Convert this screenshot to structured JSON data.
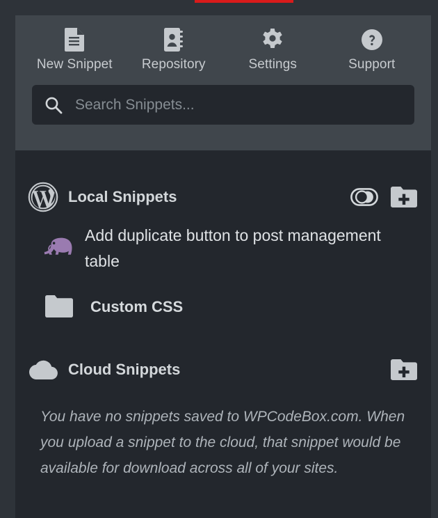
{
  "app": {
    "accent_color": "#d91b1b",
    "header_bg": "#40464c",
    "body_bg": "#23272d",
    "elephant_color": "#9a7bb0"
  },
  "nav": {
    "items": [
      {
        "label": "New Snippet",
        "icon": "document-icon"
      },
      {
        "label": "Repository",
        "icon": "address-book-icon"
      },
      {
        "label": "Settings",
        "icon": "gear-icon"
      },
      {
        "label": "Support",
        "icon": "question-circle-icon"
      }
    ]
  },
  "search": {
    "placeholder": "Search Snippets...",
    "value": "",
    "icon": "search-icon"
  },
  "local_group": {
    "title": "Local Snippets",
    "icon": "wordpress-icon",
    "toggle": {
      "name": "toggle-all-snippets",
      "state": "off"
    },
    "add_button": {
      "name": "new-folder-button",
      "icon": "folder-plus-icon"
    },
    "items": [
      {
        "label": "Add duplicate button to post management table",
        "icon": "php-elephant-icon",
        "type": "snippet"
      },
      {
        "label": "Custom CSS",
        "icon": "folder-icon",
        "type": "folder"
      }
    ]
  },
  "cloud_group": {
    "title": "Cloud Snippets",
    "icon": "cloud-icon",
    "add_button": {
      "name": "new-cloud-folder-button",
      "icon": "folder-plus-icon"
    },
    "empty_message": "You have no snippets saved to WPCodeBox.com. When you upload a snippet to the cloud, that snippet would be available for download across all of your sites."
  }
}
